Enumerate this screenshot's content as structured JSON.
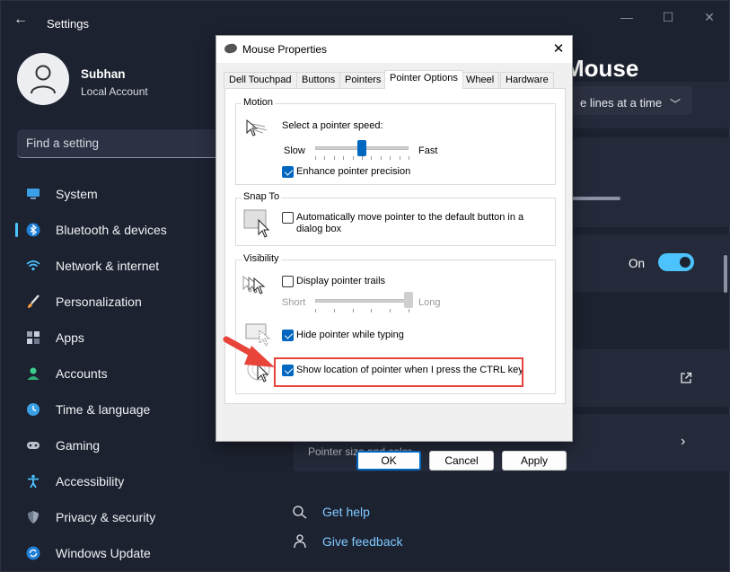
{
  "settings": {
    "app_title": "Settings",
    "profile": {
      "name": "Subhan",
      "account_type": "Local Account"
    },
    "search_placeholder": "Find a setting",
    "nav": [
      {
        "label": "System",
        "icon": "monitor-icon",
        "active": false
      },
      {
        "label": "Bluetooth & devices",
        "icon": "bluetooth-icon",
        "active": true
      },
      {
        "label": "Network & internet",
        "icon": "wifi-icon",
        "active": false
      },
      {
        "label": "Personalization",
        "icon": "brush-icon",
        "active": false
      },
      {
        "label": "Apps",
        "icon": "apps-icon",
        "active": false
      },
      {
        "label": "Accounts",
        "icon": "person-icon",
        "active": false
      },
      {
        "label": "Time & language",
        "icon": "clock-globe-icon",
        "active": false
      },
      {
        "label": "Gaming",
        "icon": "gamepad-icon",
        "active": false
      },
      {
        "label": "Accessibility",
        "icon": "accessibility-icon",
        "active": false
      },
      {
        "label": "Privacy & security",
        "icon": "shield-icon",
        "active": false
      },
      {
        "label": "Windows Update",
        "icon": "update-icon",
        "active": false
      }
    ],
    "page_title_partial": "Mouse",
    "scroll_select_partial": "e lines at a time",
    "toggle_label": "On",
    "card_sub_partial": "Pointer size and color",
    "links": [
      {
        "label": "Get help",
        "icon": "help-icon"
      },
      {
        "label": "Give feedback",
        "icon": "feedback-icon"
      }
    ],
    "colors": {
      "accent": "#4cc2ff",
      "background": "#1d2231"
    }
  },
  "dialog": {
    "title": "Mouse Properties",
    "tabs": [
      {
        "label": "Dell Touchpad",
        "active": false
      },
      {
        "label": "Buttons",
        "active": false
      },
      {
        "label": "Pointers",
        "active": false
      },
      {
        "label": "Pointer Options",
        "active": true
      },
      {
        "label": "Wheel",
        "active": false
      },
      {
        "label": "Hardware",
        "active": false
      }
    ],
    "motion": {
      "group_label": "Motion",
      "speed_label": "Select a pointer speed:",
      "slow_label": "Slow",
      "fast_label": "Fast",
      "speed_value": 0.5,
      "enhance_label": "Enhance pointer precision",
      "enhance_checked": true
    },
    "snap_to": {
      "group_label": "Snap To",
      "label_line1": "Automatically move pointer to the default button in a",
      "label_line2": "dialog box",
      "checked": false
    },
    "visibility": {
      "group_label": "Visibility",
      "trails_label": "Display pointer trails",
      "trails_checked": false,
      "short_label": "Short",
      "long_label": "Long",
      "trails_value": 1.0,
      "hide_label": "Hide pointer while typing",
      "hide_checked": true,
      "ctrl_label": "Show location of pointer when I press the CTRL key",
      "ctrl_checked": true
    },
    "buttons": {
      "ok": "OK",
      "cancel": "Cancel",
      "apply": "Apply"
    },
    "colors": {
      "accent": "#0067c0",
      "highlight": "#e8443a"
    }
  }
}
